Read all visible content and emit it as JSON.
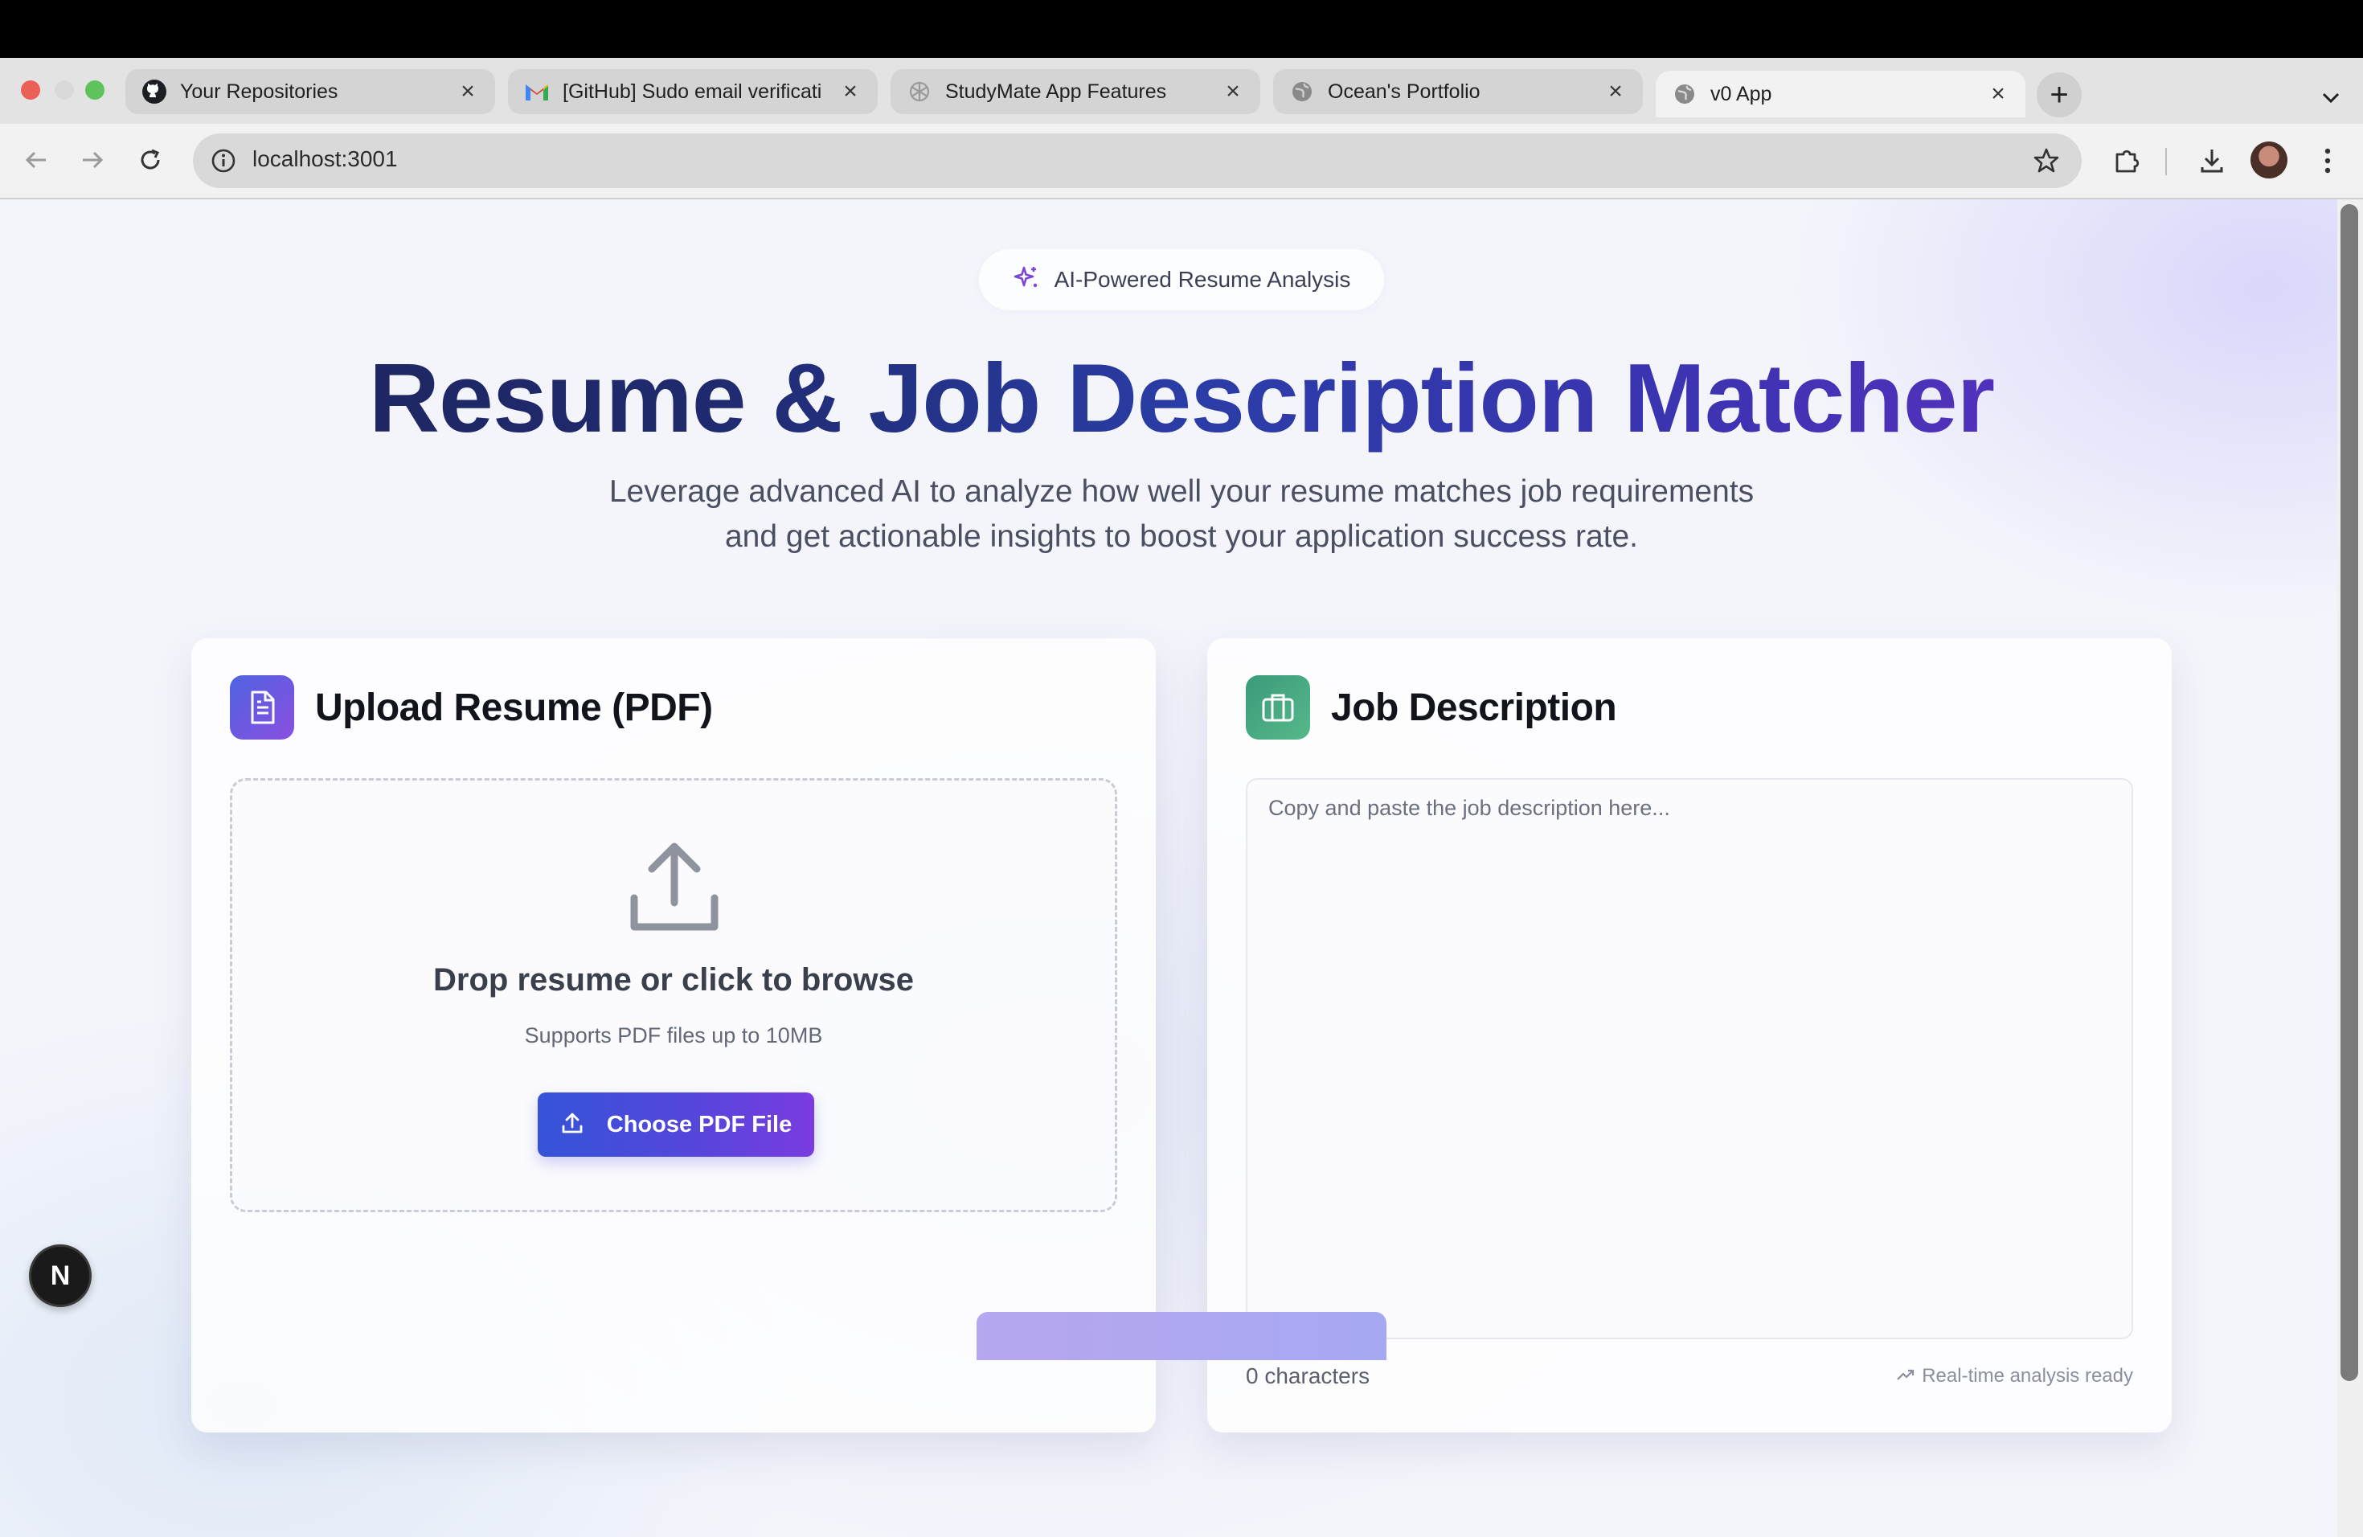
{
  "browser": {
    "tabs": [
      {
        "title": "Your Repositories",
        "icon": "github-icon",
        "active": false
      },
      {
        "title": "[GitHub] Sudo email verificati",
        "icon": "gmail-icon",
        "active": false
      },
      {
        "title": "StudyMate App Features",
        "icon": "openai-icon",
        "active": false
      },
      {
        "title": "Ocean's Portfolio",
        "icon": "globe-icon",
        "active": false
      },
      {
        "title": "v0 App",
        "icon": "globe-icon",
        "active": true
      }
    ],
    "close_glyph": "×",
    "new_tab_glyph": "+",
    "url": "localhost:3001"
  },
  "page": {
    "badge": "AI-Powered Resume Analysis",
    "title": "Resume & Job Description Matcher",
    "subtitle_line1": "Leverage advanced AI to analyze how well your resume matches job requirements",
    "subtitle_line2": "and get actionable insights to boost your application success rate.",
    "upload_card": {
      "title": "Upload Resume (PDF)",
      "drop_title": "Drop resume or click to browse",
      "drop_sub": "Supports PDF files up to 10MB",
      "button_label": "Choose PDF File"
    },
    "job_card": {
      "title": "Job Description",
      "placeholder": "Copy and paste the job description here...",
      "char_count": "0 characters",
      "status": "Real-time analysis ready"
    },
    "dev_badge": "N"
  },
  "colors": {
    "upload_icon_gradient": [
      "#4f63e0",
      "#8a4fe0"
    ],
    "job_icon_gradient": [
      "#3a9b7a",
      "#56b98a"
    ],
    "accent": "#5446da"
  }
}
